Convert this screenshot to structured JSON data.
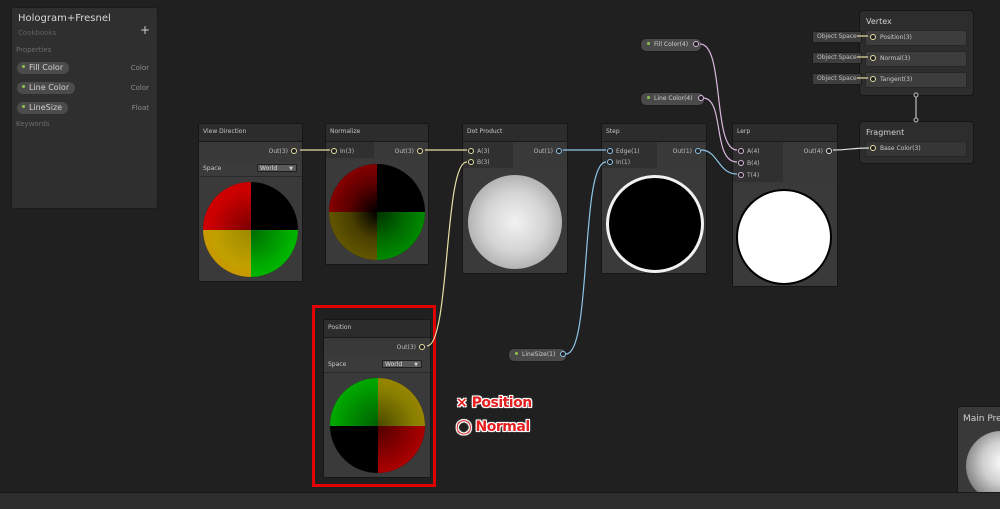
{
  "blackboard": {
    "title": "Hologram+Fresnel",
    "subtitle": "Cookbooks",
    "add_label": "+",
    "properties_header": "Properties",
    "keywords_header": "Keywords",
    "properties": [
      {
        "name": "Fill Color",
        "type": "Color"
      },
      {
        "name": "Line Color",
        "type": "Color"
      },
      {
        "name": "LineSize",
        "type": "Float"
      }
    ]
  },
  "nodes": {
    "view_direction": {
      "title": "View Direction",
      "out": "Out(3)",
      "space_label": "Space",
      "space_value": "World"
    },
    "normalize": {
      "title": "Normalize",
      "in": "In(3)",
      "out": "Out(3)"
    },
    "dot_product": {
      "title": "Dot Product",
      "in_a": "A(3)",
      "in_b": "B(3)",
      "out": "Out(1)"
    },
    "step": {
      "title": "Step",
      "in_edge": "Edge(1)",
      "in_in": "In(1)",
      "out": "Out(1)"
    },
    "lerp": {
      "title": "Lerp",
      "in_a": "A(4)",
      "in_b": "B(4)",
      "in_t": "T(4)",
      "out": "Out(4)"
    },
    "position": {
      "title": "Position",
      "out": "Out(3)",
      "space_label": "Space",
      "space_value": "World"
    }
  },
  "property_nodes": {
    "fill_color": "Fill Color(4)",
    "line_color": "Line Color(4)",
    "line_size": "LineSize(1)"
  },
  "vertex": {
    "title": "Vertex",
    "rows": [
      {
        "space": "Object Space",
        "label": "Position(3)"
      },
      {
        "space": "Object Space",
        "label": "Normal(3)"
      },
      {
        "space": "Object Space",
        "label": "Tangent(3)"
      }
    ]
  },
  "fragment": {
    "title": "Fragment",
    "base_color": "Base Color(3)"
  },
  "annotations": {
    "wrong": "× Position",
    "right": "◯ Normal"
  },
  "main_preview": {
    "title": "Main Preview"
  },
  "colors": {
    "highlight": "#e00000",
    "annotation": "#e42020",
    "wire_yellow": "#e6e0a5",
    "wire_blue": "#8ec5e8",
    "wire_pink": "#d9b6dd",
    "property_dot": "#8bc34a"
  }
}
